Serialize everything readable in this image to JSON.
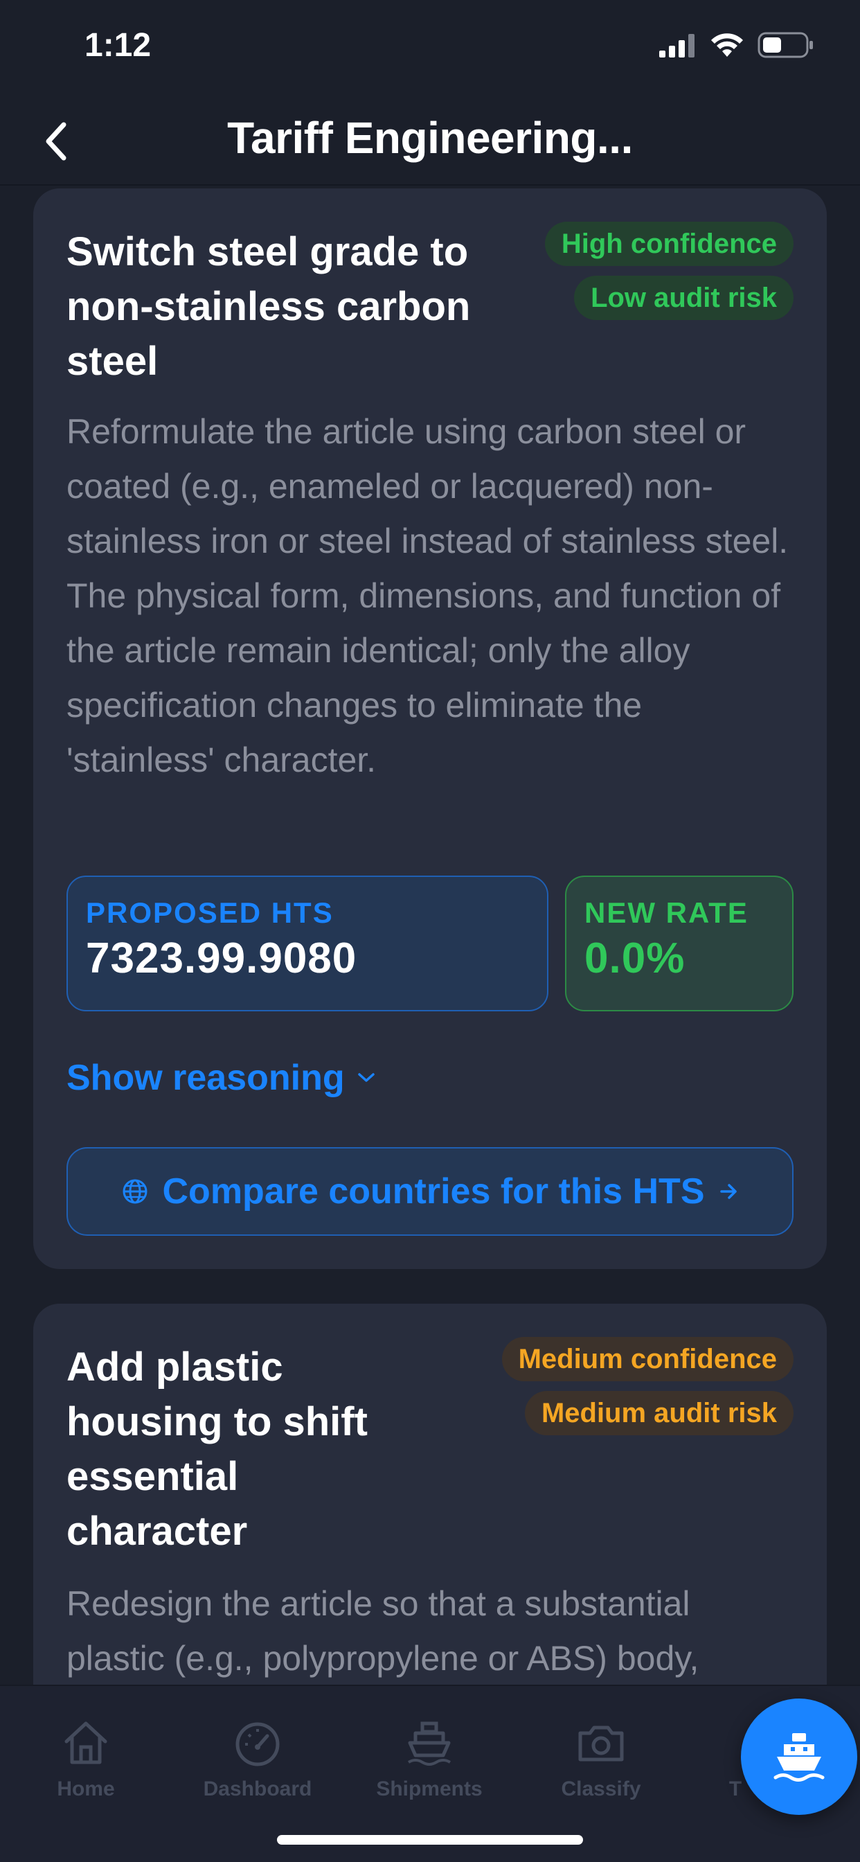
{
  "status_bar": {
    "time": "1:12"
  },
  "nav": {
    "title": "Tariff Engineering..."
  },
  "cards": [
    {
      "title": "Switch steel grade to non-stainless carbon steel",
      "confidence": "High confidence",
      "audit_risk": "Low audit risk",
      "description": "Reformulate the article using carbon steel or coated (e.g., enameled or lacquered) non-stainless iron or steel instead of stainless steel. The physical form, dimensions, and function of the article remain identical; only the alloy specification changes to eliminate the 'stainless' character.",
      "proposed_hts_label": "PROPOSED HTS",
      "proposed_hts_value": "7323.99.9080",
      "new_rate_label": "NEW RATE",
      "new_rate_value": "0.0%",
      "show_reasoning": "Show reasoning",
      "compare_button": "Compare countries for this HTS"
    },
    {
      "title": "Add plastic housing to shift essential character",
      "confidence": "Medium confidence",
      "audit_risk": "Medium audit risk",
      "description": "Redesign the article so that a substantial plastic (e.g., polypropylene or ABS) body,"
    }
  ],
  "tabbar": {
    "items": [
      {
        "label": "Home",
        "icon": "house-icon"
      },
      {
        "label": "Dashboard",
        "icon": "gauge-icon"
      },
      {
        "label": "Shipments",
        "icon": "ship-icon"
      },
      {
        "label": "Classify",
        "icon": "camera-icon"
      },
      {
        "label": "T",
        "icon": "partial-icon"
      }
    ]
  },
  "colors": {
    "background": "#1b1f2a",
    "card": "#282d3d",
    "accent_blue": "#1a84ff",
    "success_green": "#30c85a",
    "warning_orange": "#f5a623"
  }
}
